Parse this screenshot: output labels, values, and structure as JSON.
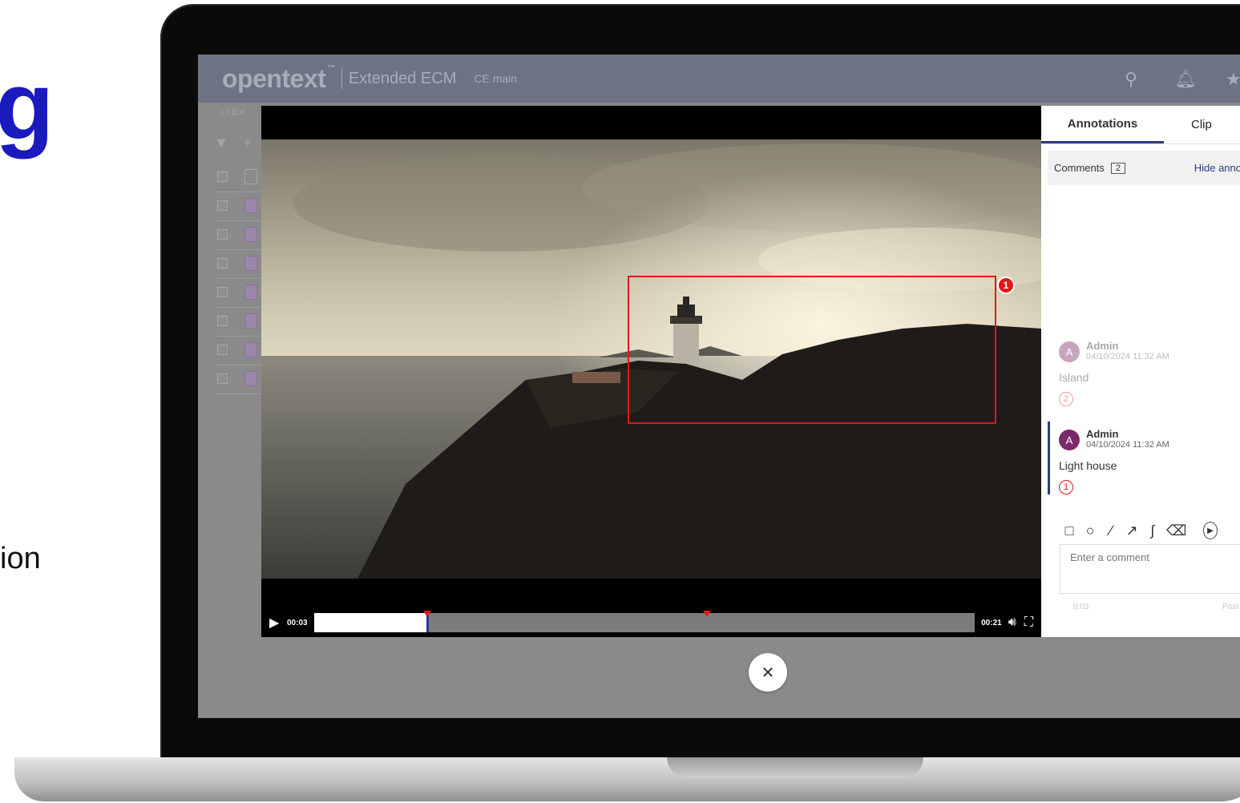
{
  "side": {
    "text1": "g",
    "text2": "ion"
  },
  "app": {
    "logo": "opentext",
    "trademark": "™",
    "product": "Extended ECM",
    "environment": "CE main"
  },
  "header_icons": [
    "search-icon",
    "bell-icon",
    "star-icon"
  ],
  "breadcrumb": {
    "home_icon": "home-icon",
    "text": "/ Ent"
  },
  "list": {
    "toolbar_icons": [
      "filter-icon",
      "plus-icon"
    ],
    "row_count": 8
  },
  "video": {
    "current_time": "00:03",
    "duration": "00:21",
    "progress_fraction": 0.1714,
    "markers_fraction": [
      0.1714,
      0.5942
    ],
    "annotation_pin": "1"
  },
  "panel": {
    "tabs": [
      {
        "label": "Annotations",
        "active": true
      },
      {
        "label": "Clip",
        "active": false
      }
    ],
    "comments_label": "Comments",
    "comments_count": "2",
    "hide_link": "Hide anno",
    "comments": [
      {
        "avatar": "A",
        "author": "Admin",
        "date": "04/10/2024 11:32 AM",
        "text": "Island",
        "number": "2",
        "selected": false
      },
      {
        "avatar": "A",
        "author": "Admin",
        "date": "04/10/2024 11:32 AM",
        "text": "Light house",
        "number": "1",
        "selected": true
      }
    ],
    "tools": [
      "rectangle-icon",
      "circle-icon",
      "line-icon",
      "arrow-icon",
      "freehand-icon",
      "eraser-icon",
      "clip-icon"
    ],
    "input_placeholder": "Enter a comment",
    "timestamp": "0:03",
    "post_label": "Post"
  },
  "colors": {
    "accent": "#2b3a80",
    "annotation": "#e01818",
    "header": "#6d7384"
  }
}
